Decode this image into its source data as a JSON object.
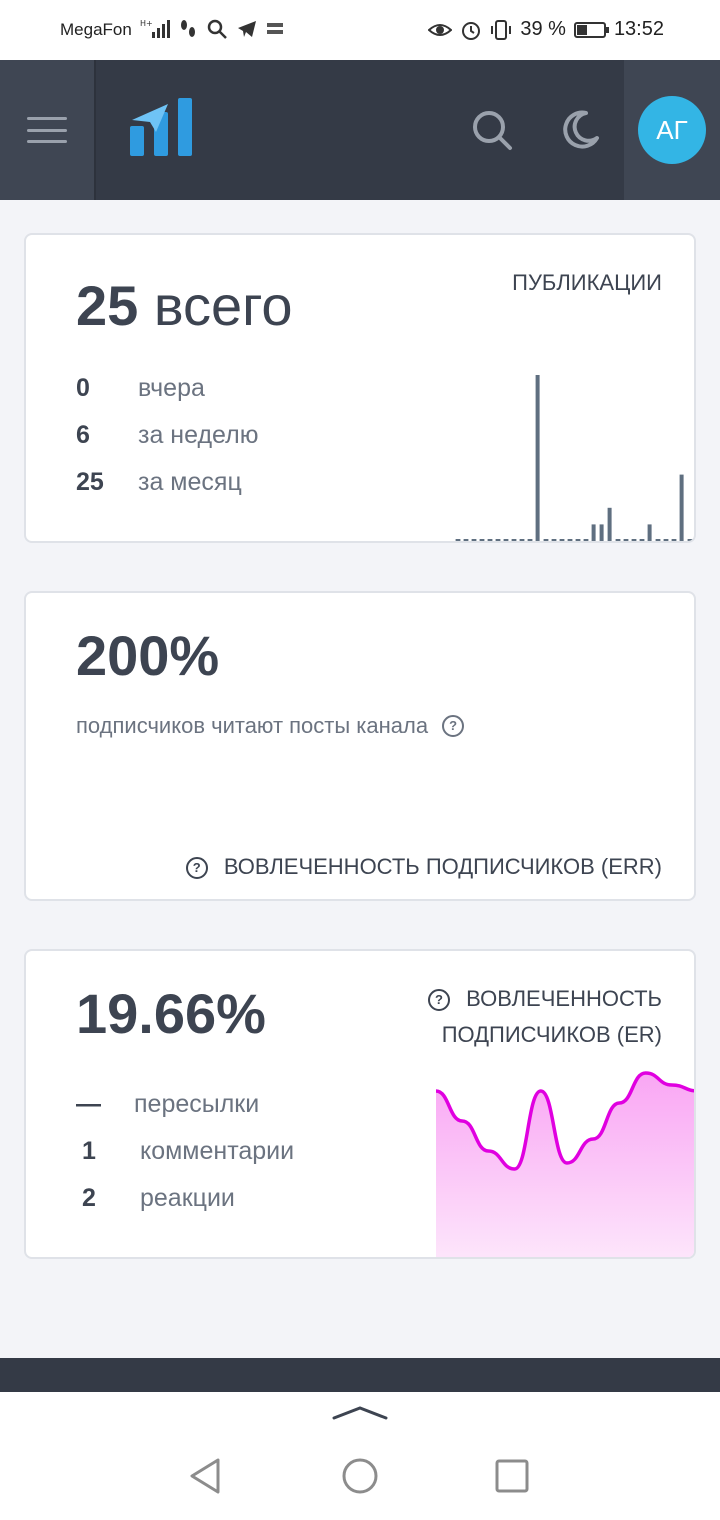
{
  "status_bar": {
    "carrier": "MegaFon",
    "battery_text": "39 %",
    "battery_level": 0.39,
    "time": "13:52"
  },
  "header": {
    "avatar_initials": "АГ",
    "avatar_color": "#33b5e5",
    "logo_color": "#2f9be0",
    "icons": [
      "menu-icon",
      "search-icon",
      "moon-icon"
    ]
  },
  "cards": {
    "publications": {
      "label": "ПУБЛИКАЦИИ",
      "total_number": "25",
      "total_suffix": "всего",
      "stats": [
        {
          "value": "0",
          "label": "вчера"
        },
        {
          "value": "6",
          "label": "за неделю"
        },
        {
          "value": "25",
          "label": "за месяц"
        }
      ]
    },
    "err": {
      "value": "200%",
      "description": "подписчиков читают посты канала",
      "label": "ВОВЛЕЧЕННОСТЬ ПОДПИСЧИКОВ (ERR)"
    },
    "er": {
      "value": "19.66%",
      "label_line1": "ВОВЛЕЧЕННОСТЬ",
      "label_line2": "ПОДПИСЧИКОВ (ER)",
      "stats": [
        {
          "value": "—",
          "label": "пересылки"
        },
        {
          "value": "1",
          "label": "комментарии"
        },
        {
          "value": "2",
          "label": "реакции"
        }
      ]
    }
  },
  "chart_data": [
    {
      "type": "bar",
      "values": [
        0,
        0,
        0,
        0,
        0,
        0,
        0,
        0,
        0,
        0,
        10,
        0,
        0,
        0,
        0,
        0,
        0,
        1,
        1,
        2,
        0,
        0,
        0,
        0,
        1,
        0,
        0,
        0,
        4,
        0
      ],
      "color": "#5f6f80"
    },
    {
      "type": "area",
      "values": [
        0.85,
        0.6,
        0.35,
        0.2,
        0.85,
        0.25,
        0.45,
        0.75,
        1.0,
        0.9,
        0.85
      ],
      "line_color": "#e000e0",
      "fill_color": "#f9a6f4"
    }
  ]
}
